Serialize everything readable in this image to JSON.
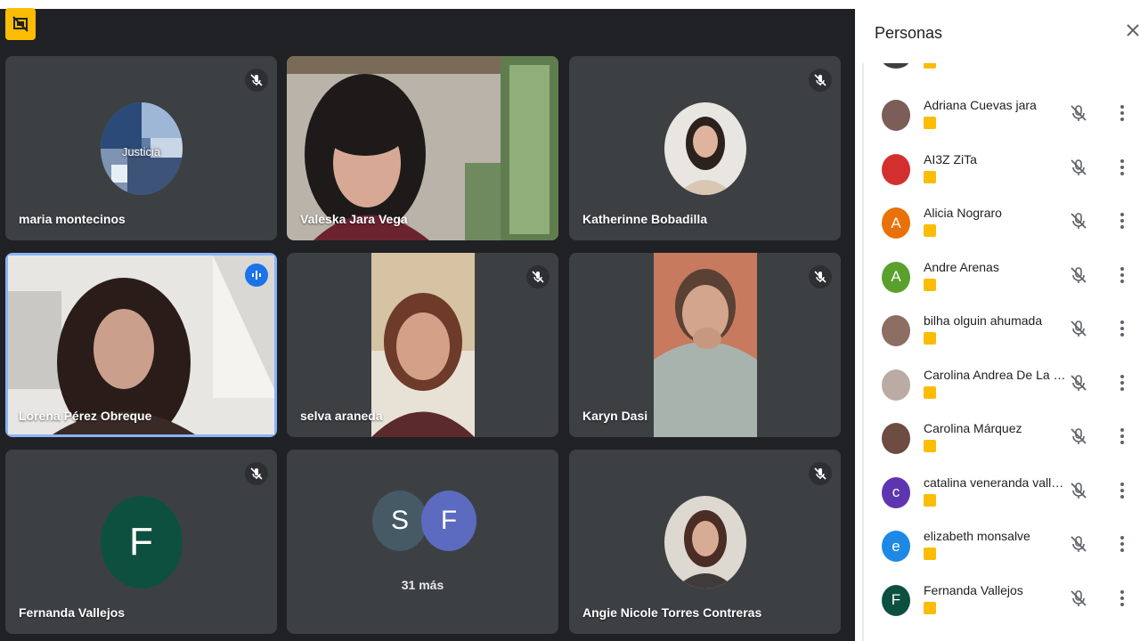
{
  "tiles": [
    {
      "name": "maria montecinos",
      "kind": "photo-avatar",
      "photo_label": "Justicia",
      "muted": true
    },
    {
      "name": "Valeska Jara Vega",
      "kind": "video",
      "muted": false
    },
    {
      "name": "Katherinne Bobadilla",
      "kind": "photo-avatar",
      "muted": true
    },
    {
      "name": "Lorena Pérez Obreque",
      "kind": "video",
      "speaking": true
    },
    {
      "name": "selva araneda",
      "kind": "video",
      "muted": true
    },
    {
      "name": "Karyn Dasi",
      "kind": "video",
      "muted": true
    },
    {
      "name": "Fernanda Vallejos",
      "kind": "letter-avatar",
      "letter": "F",
      "color": "#0d5040",
      "muted": true
    },
    {
      "name": "",
      "kind": "more",
      "avatars": [
        {
          "letter": "S",
          "color": "#455a64"
        },
        {
          "letter": "F",
          "color": "#5c6bc0"
        }
      ],
      "label": "31 más"
    },
    {
      "name": "Angie Nicole Torres Contreras",
      "kind": "photo-avatar",
      "muted": true
    }
  ],
  "panel": {
    "title": "Personas",
    "people": [
      {
        "name": "Adriana Cuevas jara",
        "avatar": "photo",
        "color": "#7b5e57"
      },
      {
        "name": "AI3Z ZiTa",
        "avatar": "photo",
        "color": "#d32f2f"
      },
      {
        "name": "Alicia Nograro",
        "avatar": "letter",
        "letter": "A",
        "color": "#e8710a"
      },
      {
        "name": "Andre Arenas",
        "avatar": "letter",
        "letter": "A",
        "color": "#5aa02c"
      },
      {
        "name": "bilha olguin ahumada",
        "avatar": "photo",
        "color": "#8d6e63"
      },
      {
        "name": "Carolina Andrea De La R...",
        "avatar": "photo",
        "color": "#bcaaa4"
      },
      {
        "name": "Carolina Márquez",
        "avatar": "photo",
        "color": "#6d4c41"
      },
      {
        "name": "catalina veneranda valle...",
        "avatar": "letter",
        "letter": "c",
        "color": "#5e35b1"
      },
      {
        "name": "elizabeth monsalve",
        "avatar": "letter",
        "letter": "e",
        "color": "#1e88e5"
      },
      {
        "name": "Fernanda Vallejos",
        "avatar": "letter",
        "letter": "F",
        "color": "#0d5040"
      }
    ]
  },
  "colors": {
    "badge": "#fbbc04",
    "speaking": "#1a73e8",
    "stage": "#202124",
    "tile": "#3c4043"
  }
}
